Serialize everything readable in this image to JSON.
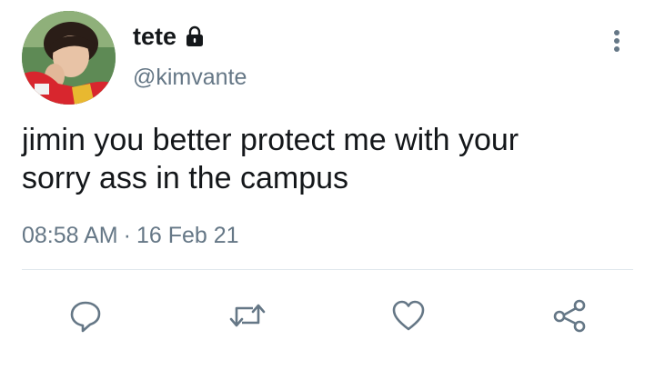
{
  "tweet": {
    "display_name": "tete",
    "handle": "@kimvante",
    "text_line1": "jimin you better protect me with your",
    "text_line2": "sorry ass in the campus",
    "time": "08:58 AM",
    "separator": "·",
    "date": "16 Feb 21"
  },
  "icons": {
    "lock": "lock-icon",
    "more": "more-vertical-icon",
    "reply": "reply-icon",
    "retweet": "retweet-icon",
    "like": "heart-icon",
    "share": "share-icon"
  },
  "colors": {
    "text": "#14171a",
    "secondary": "#657786",
    "divider": "#e1e8ed"
  }
}
